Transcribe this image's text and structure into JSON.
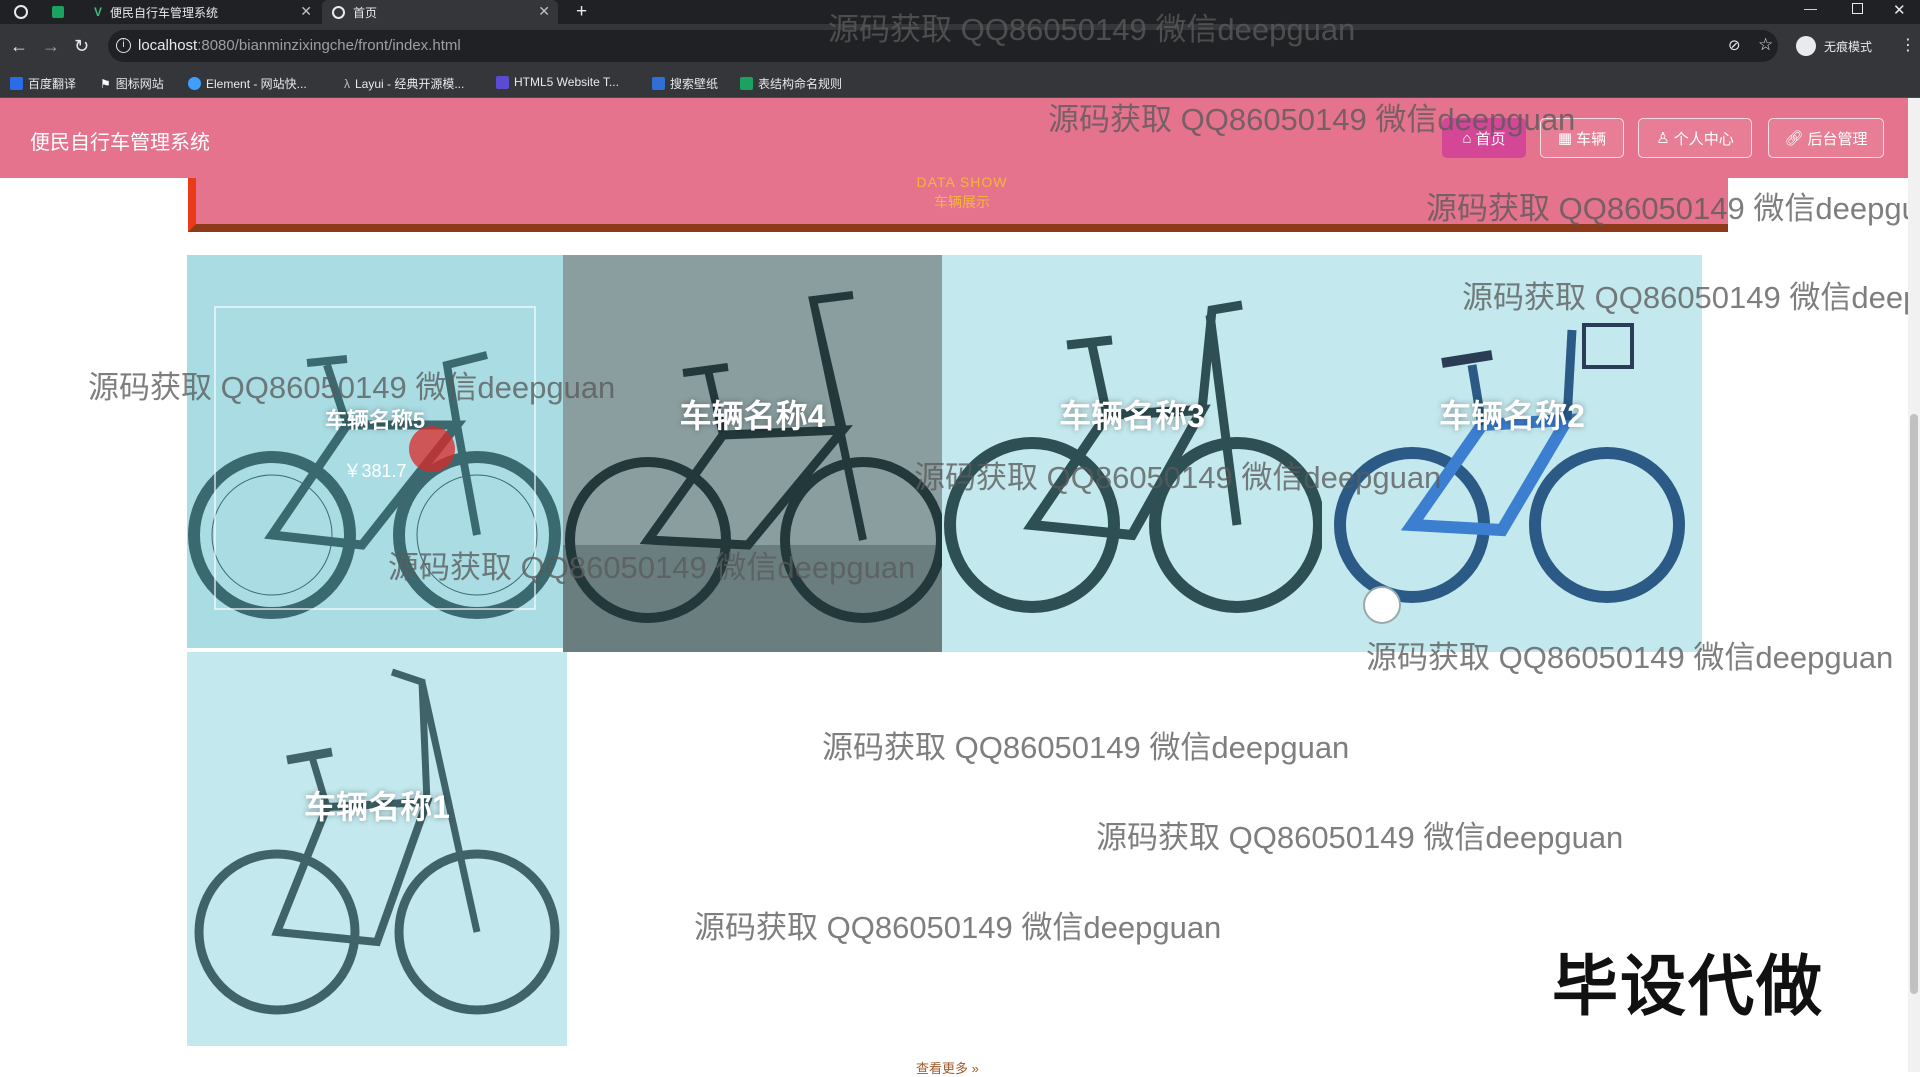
{
  "browser": {
    "tabs": [
      {
        "label": "便民自行车管理系统"
      },
      {
        "label": "首页"
      }
    ],
    "url_host": "localhost",
    "url_rest": ":8080/bianminzixingche/front/index.html",
    "profile_label": "无痕模式",
    "bookmarks": [
      {
        "label": "百度翻译",
        "color": "#2b6de8"
      },
      {
        "label": "图标网站",
        "color": "#ffffff"
      },
      {
        "label": "Element - 网站快...",
        "color": "#409eff"
      },
      {
        "label": "Layui - 经典开源模...",
        "color": "#bdbdbd"
      },
      {
        "label": "HTML5 Website T...",
        "color": "#5b4bd1"
      },
      {
        "label": "搜索壁纸",
        "color": "#2f6fd6"
      },
      {
        "label": "表结构命名规则",
        "color": "#1aa260"
      }
    ]
  },
  "header": {
    "site_title": "便民自行车管理系统",
    "nav": [
      {
        "label": "首页",
        "icon": "home-icon"
      },
      {
        "label": "车辆",
        "icon": "grid-icon"
      },
      {
        "label": "个人中心",
        "icon": "user-icon"
      },
      {
        "label": "后台管理",
        "icon": "link-icon"
      }
    ]
  },
  "section": {
    "title_en": "DATA SHOW",
    "title_cn": "车辆展示"
  },
  "vehicles": [
    {
      "name": "车辆名称5",
      "price": "￥381.7"
    },
    {
      "name": "车辆名称4"
    },
    {
      "name": "车辆名称3"
    },
    {
      "name": "车辆名称2"
    },
    {
      "name": "车辆名称1"
    }
  ],
  "more_link": "查看更多 »",
  "watermark": "源码获取 QQ86050149 微信deepguan",
  "stamp": "毕设代做",
  "colors": {
    "header_pink": "#e5738e",
    "nav_active": "#d34796",
    "card_tint": "#bfe8ee",
    "accent_orange": "#f4b63a"
  }
}
